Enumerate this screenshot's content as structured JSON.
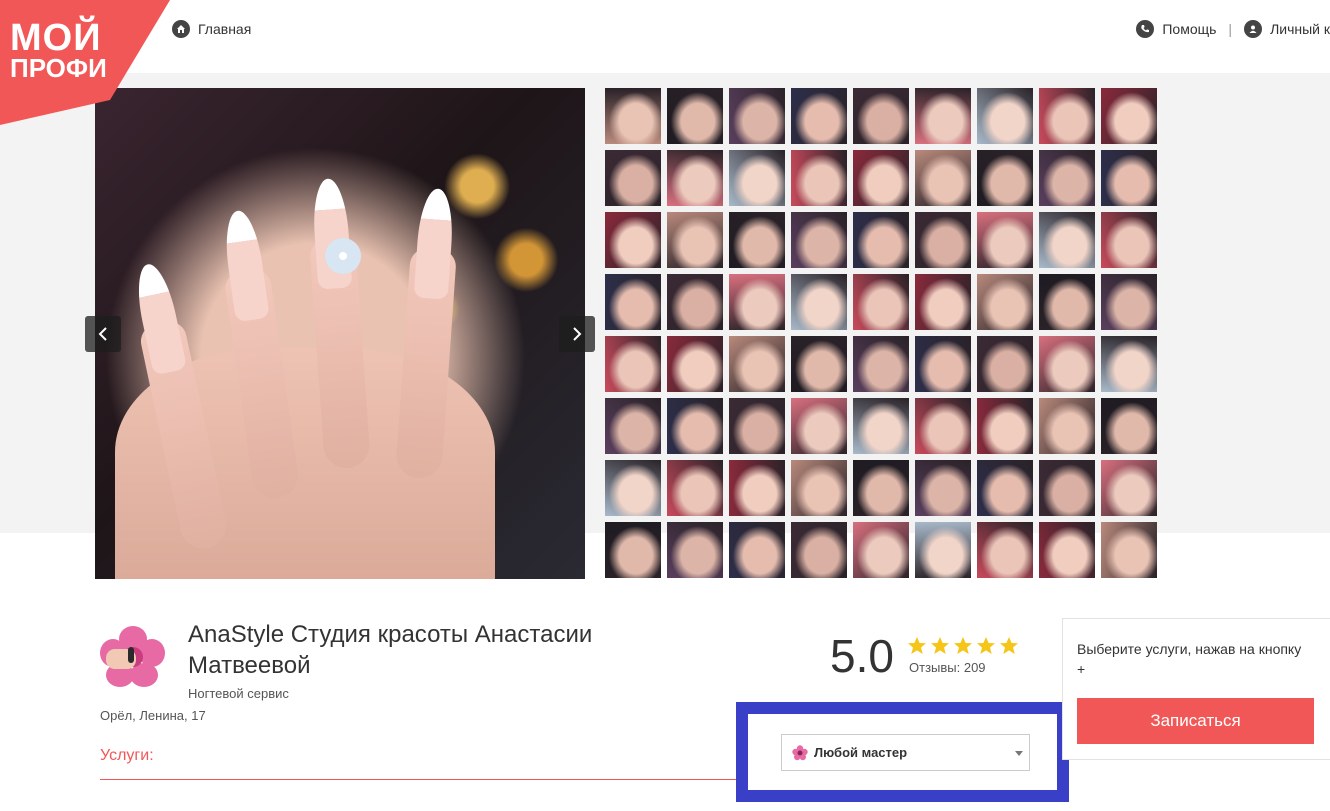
{
  "logo": {
    "line1": "МОЙ",
    "line2": "ПРОФИ",
    "icon": "gear-icon"
  },
  "nav": {
    "home_label": "Главная",
    "help_label": "Помощь",
    "separator": "|",
    "account_label": "Личный к"
  },
  "gallery": {
    "prev_icon": "chevron-left-icon",
    "next_icon": "chevron-right-icon",
    "thumb_count": 72
  },
  "salon": {
    "title": "AnaStyle Студия красоты Анастасии Матвеевой",
    "category": "Ногтевой сервис",
    "address": "Орёл, Ленина, 17"
  },
  "rating": {
    "value": "5.0",
    "stars": 5,
    "reviews_label": "Отзывы: 209"
  },
  "services": {
    "label": "Услуги:"
  },
  "master_select": {
    "value": "Любой мастер"
  },
  "booking": {
    "hint": "Выберите услуги, нажав на кнопку +",
    "button_label": "Записаться"
  },
  "colors": {
    "brand": "#f25757",
    "star": "#f5c518",
    "highlight": "#3a3fc7"
  }
}
